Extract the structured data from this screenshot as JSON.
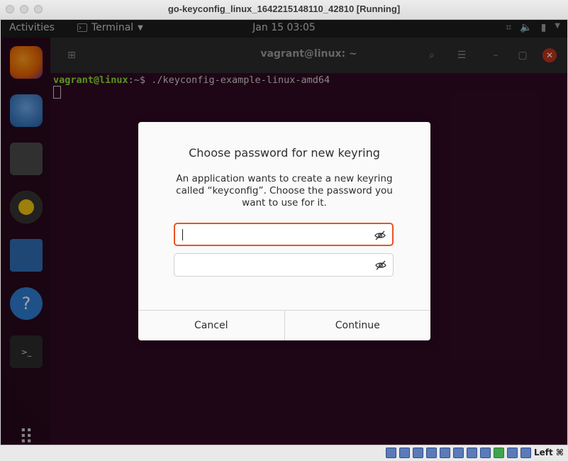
{
  "host": {
    "title": "go-keyconfig_linux_1642215148110_42810 [Running]",
    "hostkey": "Left ⌘"
  },
  "topbar": {
    "activities": "Activities",
    "app_menu": "Terminal",
    "clock": "Jan 15  03:05"
  },
  "terminal": {
    "title": "vagrant@linux: ~",
    "prompt_user": "vagrant@linux",
    "prompt_sep": ":~$ ",
    "command": "./keyconfig-example-linux-amd64"
  },
  "dialog": {
    "title": "Choose password for new keyring",
    "message": "An application wants to create a new keyring called “keyconfig”. Choose the password you want to use for it.",
    "password_value": "",
    "confirm_value": "",
    "cancel_label": "Cancel",
    "continue_label": "Continue"
  },
  "colors": {
    "accent": "#e95420",
    "desktop": "#300a24"
  },
  "icons": {
    "dock": [
      "firefox-icon",
      "thunderbird-icon",
      "files-icon",
      "rhythmbox-icon",
      "writer-icon",
      "help-icon",
      "terminal-icon",
      "apps-grid-icon"
    ]
  }
}
